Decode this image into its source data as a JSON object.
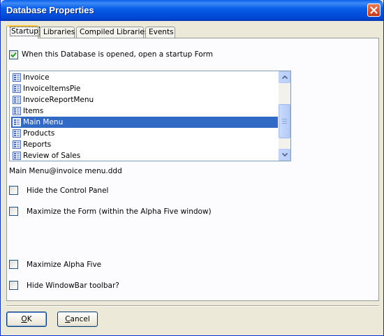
{
  "window": {
    "title": "Database Properties",
    "close_icon": "close-icon"
  },
  "tabs": [
    {
      "label": "Startup",
      "active": true
    },
    {
      "label": "Libraries",
      "active": false
    },
    {
      "label": "Compiled Libraries",
      "active": false
    },
    {
      "label": "Events",
      "active": false
    }
  ],
  "startup": {
    "open_form_label": "When this Database is opened, open a startup Form",
    "open_form_checked": true,
    "forms": [
      {
        "label": "Invoice",
        "selected": false
      },
      {
        "label": "InvoiceItemsPie",
        "selected": false
      },
      {
        "label": "InvoiceReportMenu",
        "selected": false
      },
      {
        "label": "Items",
        "selected": false
      },
      {
        "label": "Main Menu",
        "selected": true
      },
      {
        "label": "Products",
        "selected": false
      },
      {
        "label": "Reports",
        "selected": false
      },
      {
        "label": "Review of Sales",
        "selected": false
      }
    ],
    "selected_path": "Main Menu@invoice menu.ddd",
    "options": [
      {
        "label": "Hide the Control Panel",
        "checked": false
      },
      {
        "label": "Maximize the Form (within the Alpha Five window)",
        "checked": false
      },
      {
        "label": "Maximize Alpha Five",
        "checked": false
      },
      {
        "label": "Hide WindowBar toolbar?",
        "checked": false
      }
    ]
  },
  "buttons": {
    "ok": {
      "hotkey": "O",
      "rest": "K"
    },
    "cancel": {
      "hotkey": "C",
      "rest": "ancel"
    }
  },
  "colors": {
    "titlebar": "#0a5fe8",
    "selection": "#316ac5",
    "dialog_bg": "#ece9d8",
    "checkmark": "#21a121"
  }
}
